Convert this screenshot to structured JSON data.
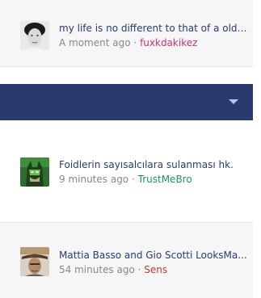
{
  "colors": {
    "band": "#2a3a6e",
    "title_text": "#2b3a73",
    "meta_text": "#888888",
    "author_pink": "#c4327a",
    "author_green": "#19946a",
    "author_red": "#c33a2c"
  },
  "feed": [
    {
      "title": "my life is no different to that of a old ...",
      "time": "A moment ago",
      "separator": "·",
      "author": "fuxkdakikez",
      "author_color": "#c4327a"
    },
    {
      "title": "Foidlerin sayısalcılara sulanması hk.",
      "time": "9 minutes ago",
      "separator": "·",
      "author": "TrustMeBro",
      "author_color": "#19946a"
    },
    {
      "title": "Mattia Basso and Gio Scotti LooksMa...",
      "time": "54 minutes ago",
      "separator": "·",
      "author": "Sens",
      "author_color": "#c33a2c"
    }
  ],
  "band": {
    "chevron_icon": "chevron-down-icon"
  }
}
